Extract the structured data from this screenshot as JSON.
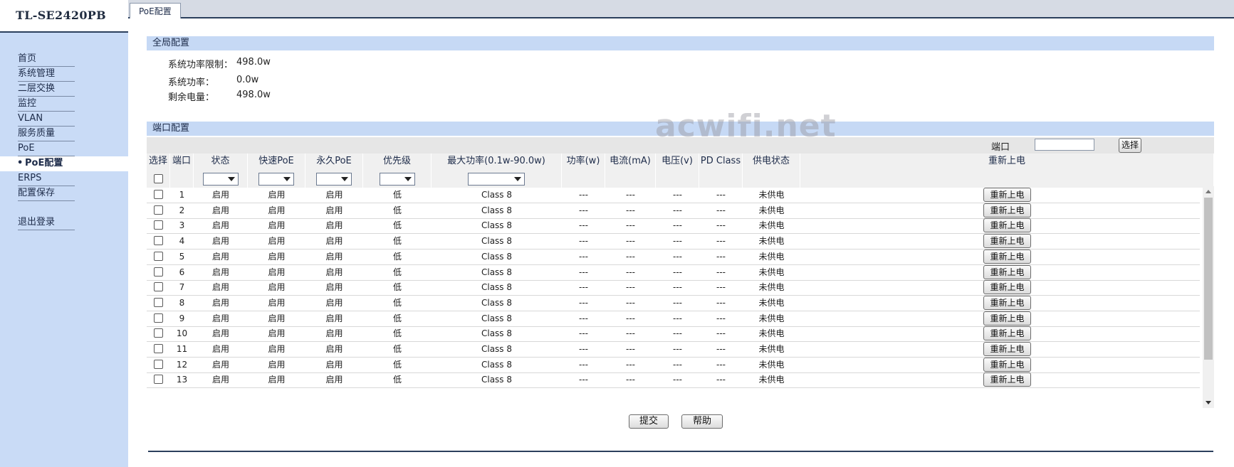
{
  "brand": "TL-SE2420PB",
  "active_tab": "PoE配置",
  "sidebar": {
    "items": [
      {
        "label": "首页",
        "active": false
      },
      {
        "label": "系统管理",
        "active": false
      },
      {
        "label": "二层交换",
        "active": false
      },
      {
        "label": "监控",
        "active": false
      },
      {
        "label": "VLAN",
        "active": false
      },
      {
        "label": "服务质量",
        "active": false
      },
      {
        "label": "PoE",
        "active": false
      },
      {
        "label": "PoE配置",
        "active": true
      },
      {
        "label": "ERPS",
        "active": false
      },
      {
        "label": "配置保存",
        "active": false
      },
      {
        "label": "",
        "gap": true
      },
      {
        "label": "退出登录",
        "active": false
      }
    ]
  },
  "global": {
    "title": "全局配置",
    "power_limit_label": "系统功率限制：",
    "power_limit_value": "498.0w",
    "power_label": "系统功率：",
    "power_value": "0.0w",
    "remaining_label": "剩余电量：",
    "remaining_value": "498.0w"
  },
  "port_config": {
    "title": "端口配置",
    "filter_label": "端口",
    "filter_value": "",
    "filter_button": "选择",
    "columns": [
      "选择",
      "端口",
      "状态",
      "快速PoE",
      "永久PoE",
      "优先级",
      "最大功率(0.1w-90.0w)",
      "功率(w)",
      "电流(mA)",
      "电压(v)",
      "PD Class",
      "供电状态",
      "重新上电"
    ],
    "rows": [
      {
        "port": "1",
        "status": "启用",
        "fast_poe": "启用",
        "perpetual_poe": "启用",
        "priority": "低",
        "max_power": "Class 8",
        "power": "---",
        "current": "---",
        "voltage": "---",
        "pd_class": "---",
        "supply_status": "未供电",
        "action": "重新上电"
      },
      {
        "port": "2",
        "status": "启用",
        "fast_poe": "启用",
        "perpetual_poe": "启用",
        "priority": "低",
        "max_power": "Class 8",
        "power": "---",
        "current": "---",
        "voltage": "---",
        "pd_class": "---",
        "supply_status": "未供电",
        "action": "重新上电"
      },
      {
        "port": "3",
        "status": "启用",
        "fast_poe": "启用",
        "perpetual_poe": "启用",
        "priority": "低",
        "max_power": "Class 8",
        "power": "---",
        "current": "---",
        "voltage": "---",
        "pd_class": "---",
        "supply_status": "未供电",
        "action": "重新上电"
      },
      {
        "port": "4",
        "status": "启用",
        "fast_poe": "启用",
        "perpetual_poe": "启用",
        "priority": "低",
        "max_power": "Class 8",
        "power": "---",
        "current": "---",
        "voltage": "---",
        "pd_class": "---",
        "supply_status": "未供电",
        "action": "重新上电"
      },
      {
        "port": "5",
        "status": "启用",
        "fast_poe": "启用",
        "perpetual_poe": "启用",
        "priority": "低",
        "max_power": "Class 8",
        "power": "---",
        "current": "---",
        "voltage": "---",
        "pd_class": "---",
        "supply_status": "未供电",
        "action": "重新上电"
      },
      {
        "port": "6",
        "status": "启用",
        "fast_poe": "启用",
        "perpetual_poe": "启用",
        "priority": "低",
        "max_power": "Class 8",
        "power": "---",
        "current": "---",
        "voltage": "---",
        "pd_class": "---",
        "supply_status": "未供电",
        "action": "重新上电"
      },
      {
        "port": "7",
        "status": "启用",
        "fast_poe": "启用",
        "perpetual_poe": "启用",
        "priority": "低",
        "max_power": "Class 8",
        "power": "---",
        "current": "---",
        "voltage": "---",
        "pd_class": "---",
        "supply_status": "未供电",
        "action": "重新上电"
      },
      {
        "port": "8",
        "status": "启用",
        "fast_poe": "启用",
        "perpetual_poe": "启用",
        "priority": "低",
        "max_power": "Class 8",
        "power": "---",
        "current": "---",
        "voltage": "---",
        "pd_class": "---",
        "supply_status": "未供电",
        "action": "重新上电"
      },
      {
        "port": "9",
        "status": "启用",
        "fast_poe": "启用",
        "perpetual_poe": "启用",
        "priority": "低",
        "max_power": "Class 8",
        "power": "---",
        "current": "---",
        "voltage": "---",
        "pd_class": "---",
        "supply_status": "未供电",
        "action": "重新上电"
      },
      {
        "port": "10",
        "status": "启用",
        "fast_poe": "启用",
        "perpetual_poe": "启用",
        "priority": "低",
        "max_power": "Class 8",
        "power": "---",
        "current": "---",
        "voltage": "---",
        "pd_class": "---",
        "supply_status": "未供电",
        "action": "重新上电"
      },
      {
        "port": "11",
        "status": "启用",
        "fast_poe": "启用",
        "perpetual_poe": "启用",
        "priority": "低",
        "max_power": "Class 8",
        "power": "---",
        "current": "---",
        "voltage": "---",
        "pd_class": "---",
        "supply_status": "未供电",
        "action": "重新上电"
      },
      {
        "port": "12",
        "status": "启用",
        "fast_poe": "启用",
        "perpetual_poe": "启用",
        "priority": "低",
        "max_power": "Class 8",
        "power": "---",
        "current": "---",
        "voltage": "---",
        "pd_class": "---",
        "supply_status": "未供电",
        "action": "重新上电"
      },
      {
        "port": "13",
        "status": "启用",
        "fast_poe": "启用",
        "perpetual_poe": "启用",
        "priority": "低",
        "max_power": "Class 8",
        "power": "---",
        "current": "---",
        "voltage": "---",
        "pd_class": "---",
        "supply_status": "未供电",
        "action": "重新上电"
      }
    ]
  },
  "footer": {
    "submit": "提交",
    "help": "帮助"
  },
  "watermark": "acwifi.net"
}
